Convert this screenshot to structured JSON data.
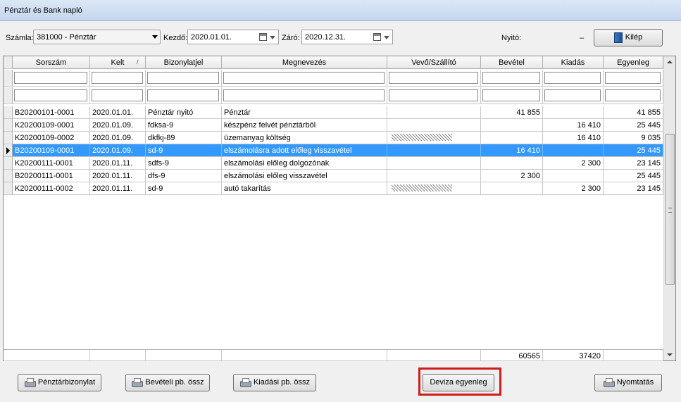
{
  "window": {
    "title": "Pénztár és Bank napló"
  },
  "toolbar": {
    "account_label": "Számla:",
    "account_value": "381000 - Pénztár",
    "start_label": "Kezdő:",
    "start_value": "2020.01.01.",
    "end_label": "Záró:",
    "end_value": "2020.12.31.",
    "opening_label": "Nyitó:",
    "opening_value": "–",
    "exit_label": "Kilép"
  },
  "table": {
    "columns": [
      "Sorszám",
      "Kelt",
      "Bizonylatjel",
      "Megnevezés",
      "Vevő/Szállító",
      "Bevétel",
      "Kiadás",
      "Egyenleg"
    ],
    "sort_indicator": "/",
    "rows": [
      [
        "B20200101-0001",
        "2020.01.01.",
        "Pénztár nyitó",
        "Pénztár",
        "",
        "41 855",
        "",
        "41 855"
      ],
      [
        "K20200109-0001",
        "2020.01.09.",
        "fdksa-9",
        "készpénz felvét pénztárból",
        "",
        "",
        "16 410",
        "25 445"
      ],
      [
        "K20200109-0002",
        "2020.01.09.",
        "dkfkj-89",
        "üzemanyag költség",
        "",
        "",
        "16 410",
        "9 035"
      ],
      [
        "B20200109-0001",
        "2020.01.09.",
        "sd-9",
        "elszámolásra adott előleg visszavétel",
        "",
        "16 410",
        "",
        "25 445"
      ],
      [
        "K20200111-0001",
        "2020.01.11.",
        "sdfs-9",
        "elszámolási előleg dolgozónak",
        "",
        "",
        "2 300",
        "23 145"
      ],
      [
        "B20200111-0001",
        "2020.01.11.",
        "dfs-9",
        "elszámolási előleg visszavétel",
        "",
        "2 300",
        "",
        "25 445"
      ],
      [
        "K20200111-0002",
        "2020.01.11.",
        "sd-9",
        "autó takarítás",
        "",
        "",
        "2 300",
        "23 145"
      ]
    ],
    "selected_row": 3,
    "totals": {
      "bevetel": "60565",
      "kiadas": "37420"
    }
  },
  "buttons": {
    "cash_voucher": "Pénztárbizonylat",
    "income_summary": "Bevételi pb. össz",
    "expense_summary": "Kiadási pb. össz",
    "currency_balance": "Deviza egyenleg",
    "print": "Nyomtatás"
  },
  "colors": {
    "selection": "#3399ff",
    "highlight_box": "#d01c1c"
  }
}
